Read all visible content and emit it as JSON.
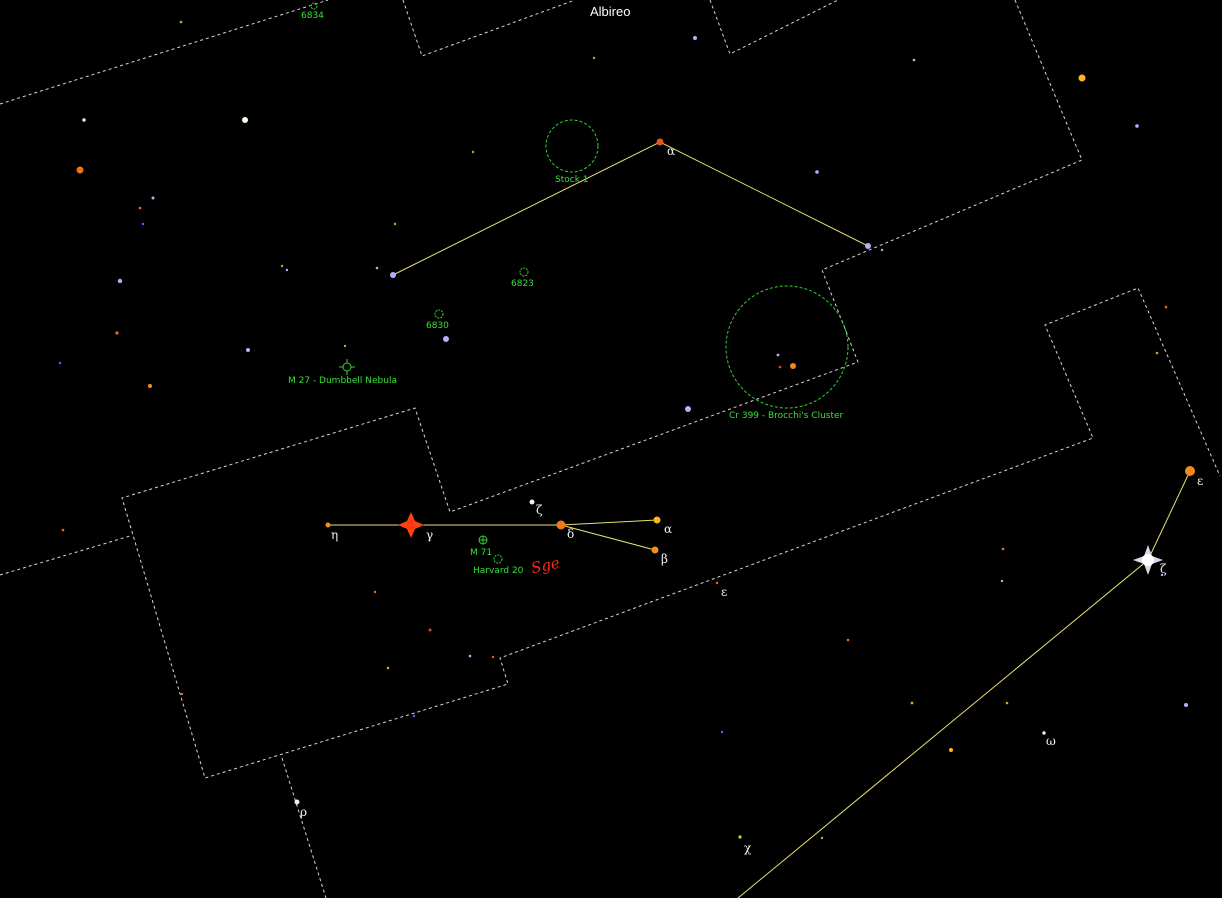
{
  "star_names": {
    "albireo": "Albireo"
  },
  "greek_labels": {
    "sge_alpha_upper": "α",
    "sge_eta": "η",
    "sge_gamma": "γ",
    "sge_zeta": "ζ",
    "sge_delta": "δ",
    "sge_alpha": "α",
    "sge_beta": "β",
    "aql_epsilon_small": "ε",
    "aql_epsilon": "ε",
    "aql_zeta": "ζ",
    "aql_omega": "ω",
    "aql_chi": "χ",
    "aql_rho": "ρ"
  },
  "deep_sky": {
    "ngc6834": "6834",
    "stock1": "Stock 1",
    "ngc6823": "6823",
    "ngc6830": "6830",
    "m27": "M 27 - Dumbbell Nebula",
    "cr399": "Cr 399 - Brocchi's Cluster",
    "m71": "M 71",
    "harvard20": "Harvard 20"
  },
  "annotation": {
    "comet_mark": "Sge"
  },
  "colors": {
    "background": "#000000",
    "boundary": "#d8d8d8",
    "figure_line": "#e8e070",
    "deep_sky": "#38e038",
    "marker_red": "#ff2a1a"
  }
}
